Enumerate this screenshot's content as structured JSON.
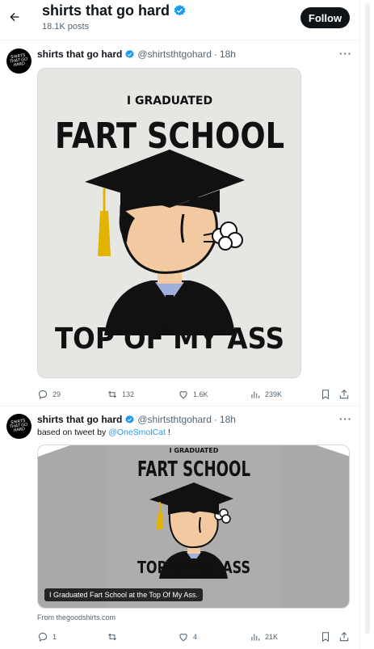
{
  "header": {
    "title": "shirts that go hard",
    "post_count": "18.1K posts",
    "follow_label": "Follow"
  },
  "avatar_text": "SHIRTS\nTHAT GO\nHARD",
  "tweets": [
    {
      "name": "shirts that go hard",
      "handle": "@shirtsthtgohard",
      "time": "18h",
      "more": "···",
      "shirt": {
        "line1": "I GRADUATED",
        "line2": "FART SCHOOL",
        "line3": "TOP OF MY ASS"
      },
      "stats": {
        "replies": "29",
        "reposts": "132",
        "likes": "1.6K",
        "views": "239K"
      }
    },
    {
      "name": "shirts that go hard",
      "handle": "@shirtsthtgohard",
      "time": "18h",
      "more": "···",
      "text_prefix": "based on tweet by ",
      "mention": "@OneSmolCat",
      "text_suffix": " !",
      "shirt": {
        "line1": "I GRADUATED",
        "line2": "FART SCHOOL",
        "line3": "TOP OF MY ASS"
      },
      "caption": "I Graduated Fart School at the Top Of My Ass.",
      "source": "From thegoodshirts.com",
      "stats": {
        "replies": "1",
        "reposts": "",
        "likes": "4",
        "views": "21K"
      }
    }
  ],
  "colors": {
    "accent": "#1d9bf0",
    "text": "#0f1419",
    "muted": "#536471",
    "cap": "#111111",
    "tassel": "#e0b400",
    "skin": "#f2c9a0",
    "tie": "#9fb0de"
  }
}
